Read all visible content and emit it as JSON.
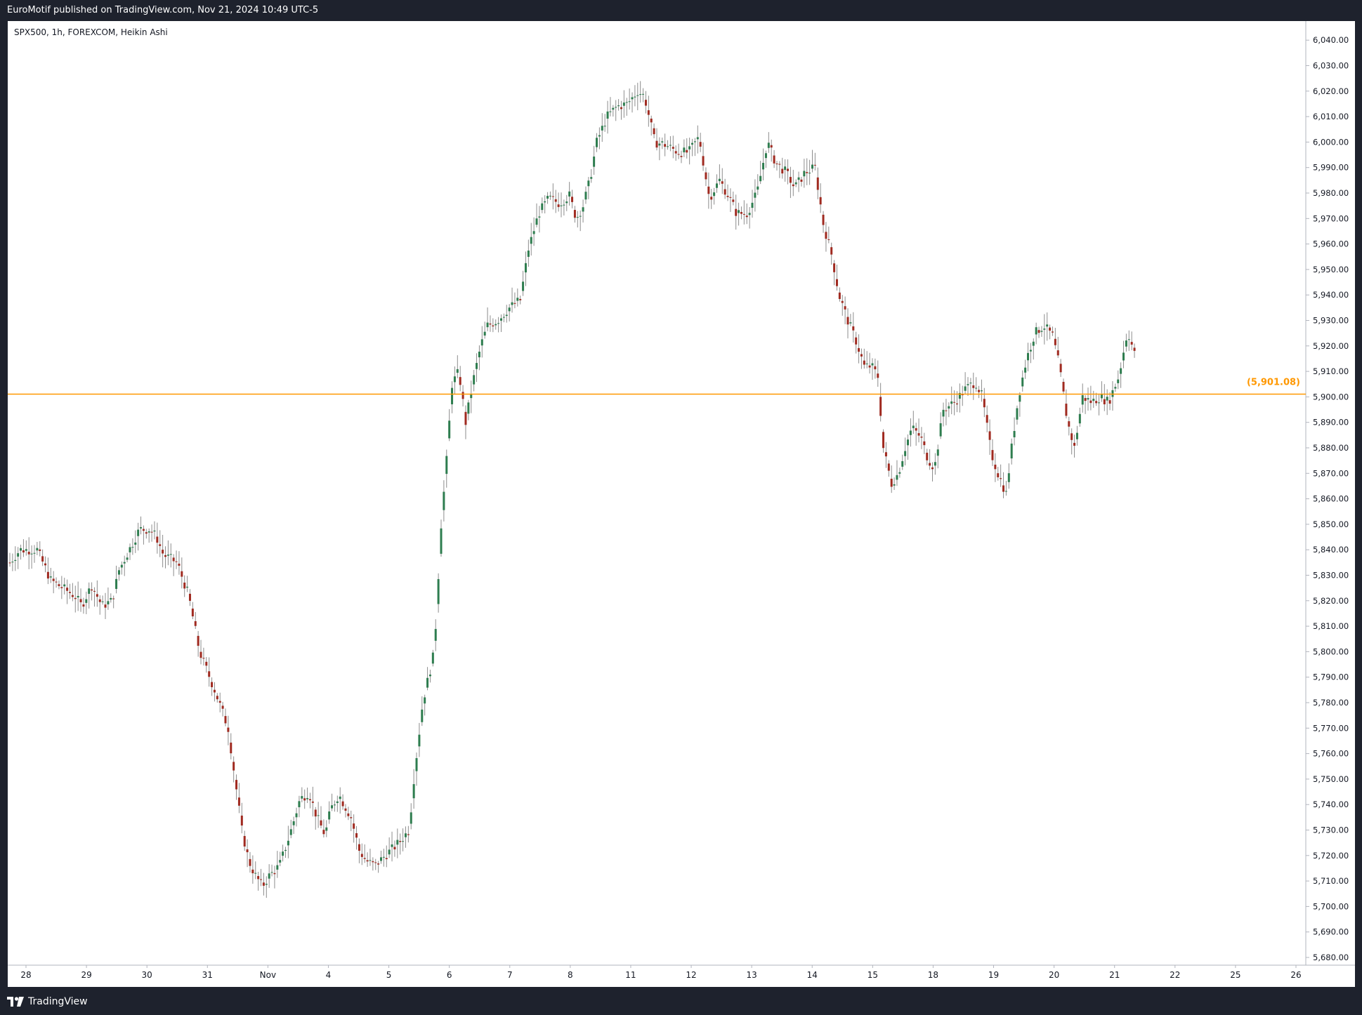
{
  "header": {
    "publish_text": "EuroMotif published on TradingView.com, Nov 21, 2024 10:49 UTC-5"
  },
  "footer": {
    "brand_label": "TradingView",
    "logo_icon": "tradingview-logo-icon"
  },
  "colors": {
    "up": "#2e7d4f",
    "down": "#a02a20",
    "wick": "#8c8c8c",
    "level_line": "#ff9800",
    "axis_text": "#131722",
    "grid_border": "#e0e3eb"
  },
  "chart_data": {
    "type": "candlestick",
    "chart_style": "Heikin Ashi",
    "legend_text": "SPX500, 1h, FOREXCOM, Heikin Ashi",
    "y_axis": {
      "min": 5680,
      "max": 6040,
      "ticks": [
        "6,040.00",
        "6,030.00",
        "6,020.00",
        "6,010.00",
        "6,000.00",
        "5,990.00",
        "5,980.00",
        "5,970.00",
        "5,960.00",
        "5,950.00",
        "5,940.00",
        "5,930.00",
        "5,920.00",
        "5,910.00",
        "5,900.00",
        "5,890.00",
        "5,880.00",
        "5,870.00",
        "5,860.00",
        "5,850.00",
        "5,840.00",
        "5,830.00",
        "5,820.00",
        "5,810.00",
        "5,800.00",
        "5,790.00",
        "5,780.00",
        "5,770.00",
        "5,760.00",
        "5,750.00",
        "5,740.00",
        "5,730.00",
        "5,720.00",
        "5,710.00",
        "5,700.00",
        "5,690.00",
        "5,680.00"
      ],
      "tick_values": [
        6040,
        6030,
        6020,
        6010,
        6000,
        5990,
        5980,
        5970,
        5960,
        5950,
        5940,
        5930,
        5920,
        5910,
        5900,
        5890,
        5880,
        5870,
        5860,
        5850,
        5840,
        5830,
        5820,
        5810,
        5800,
        5790,
        5780,
        5770,
        5760,
        5750,
        5740,
        5730,
        5720,
        5710,
        5700,
        5690,
        5680
      ]
    },
    "x_axis": {
      "labels": [
        "28",
        "29",
        "30",
        "31",
        "Nov",
        "4",
        "5",
        "6",
        "7",
        "8",
        "11",
        "12",
        "13",
        "14",
        "15",
        "18",
        "19",
        "20",
        "21",
        "22",
        "25",
        "26"
      ]
    },
    "level": {
      "value": 5901.08,
      "label": "(5,901.08)"
    },
    "bar_ranges_approx": [
      {
        "day": "28",
        "low": 5810,
        "high": 5848,
        "close": 5830
      },
      {
        "day": "29",
        "low": 5812,
        "high": 5845,
        "close": 5826
      },
      {
        "day": "30",
        "low": 5810,
        "high": 5857,
        "close": 5840
      },
      {
        "day": "31",
        "low": 5760,
        "high": 5833,
        "close": 5765
      },
      {
        "day": "Nov",
        "low": 5701,
        "high": 5772,
        "close": 5715
      },
      {
        "day": "4",
        "low": 5703,
        "high": 5748,
        "close": 5735
      },
      {
        "day": "5",
        "low": 5696,
        "high": 5730,
        "close": 5725
      },
      {
        "day": "6",
        "low": 5725,
        "high": 5924,
        "close": 5905
      },
      {
        "day": "7",
        "low": 5870,
        "high": 5942,
        "close": 5935
      },
      {
        "day": "8",
        "low": 5935,
        "high": 5985,
        "close": 5978
      },
      {
        "day": "11",
        "low": 5965,
        "high": 6027,
        "close": 6018
      },
      {
        "day": "12",
        "low": 5987,
        "high": 6010,
        "close": 5995
      },
      {
        "day": "13",
        "low": 5960,
        "high": 6008,
        "close": 5985
      },
      {
        "day": "14",
        "low": 5950,
        "high": 6008,
        "close": 5948
      },
      {
        "day": "15",
        "low": 5852,
        "high": 5933,
        "close": 5865
      },
      {
        "day": "18",
        "low": 5862,
        "high": 5907,
        "close": 5895
      },
      {
        "day": "19",
        "low": 5831,
        "high": 5909,
        "close": 5875
      },
      {
        "day": "20",
        "low": 5858,
        "high": 5935,
        "close": 5900
      },
      {
        "day": "21",
        "low": 5884,
        "high": 5949,
        "close": 5910
      }
    ]
  }
}
